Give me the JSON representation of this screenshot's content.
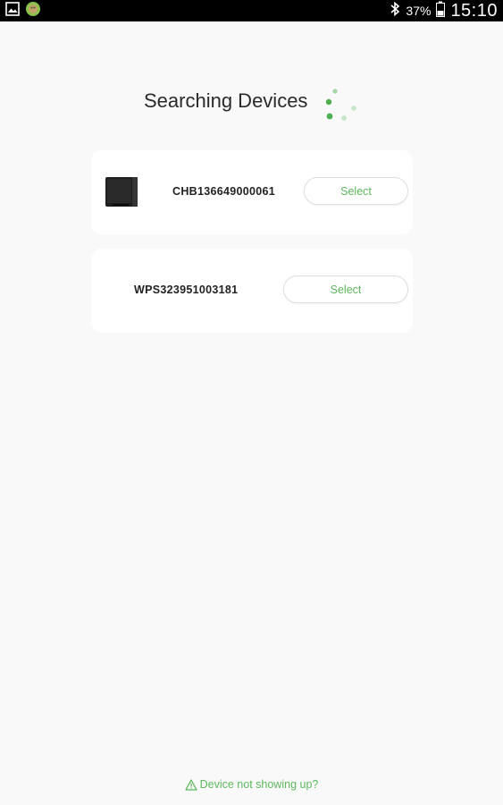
{
  "status_bar": {
    "left_icons": [
      "gallery-icon",
      "android-app-icon"
    ],
    "bluetooth_icon": "bluetooth-icon",
    "battery_percent": "37%",
    "battery_icon": "battery-icon",
    "time": "15:10"
  },
  "header": {
    "title": "Searching Devices",
    "spinner_icon": "loading-spinner-icon"
  },
  "devices": [
    {
      "image_icon": "device-box-icon",
      "id": "CHB136649000061",
      "select_label": "Select"
    },
    {
      "id": "WPS323951003181",
      "select_label": "Select"
    }
  ],
  "footer": {
    "help_icon": "warning-triangle-icon",
    "help_text": "Device not showing up?"
  },
  "colors": {
    "accent": "#5cb85c",
    "background": "#f9f9f9",
    "card": "#ffffff",
    "status_bar": "#000000",
    "text": "#2a2a2a"
  }
}
